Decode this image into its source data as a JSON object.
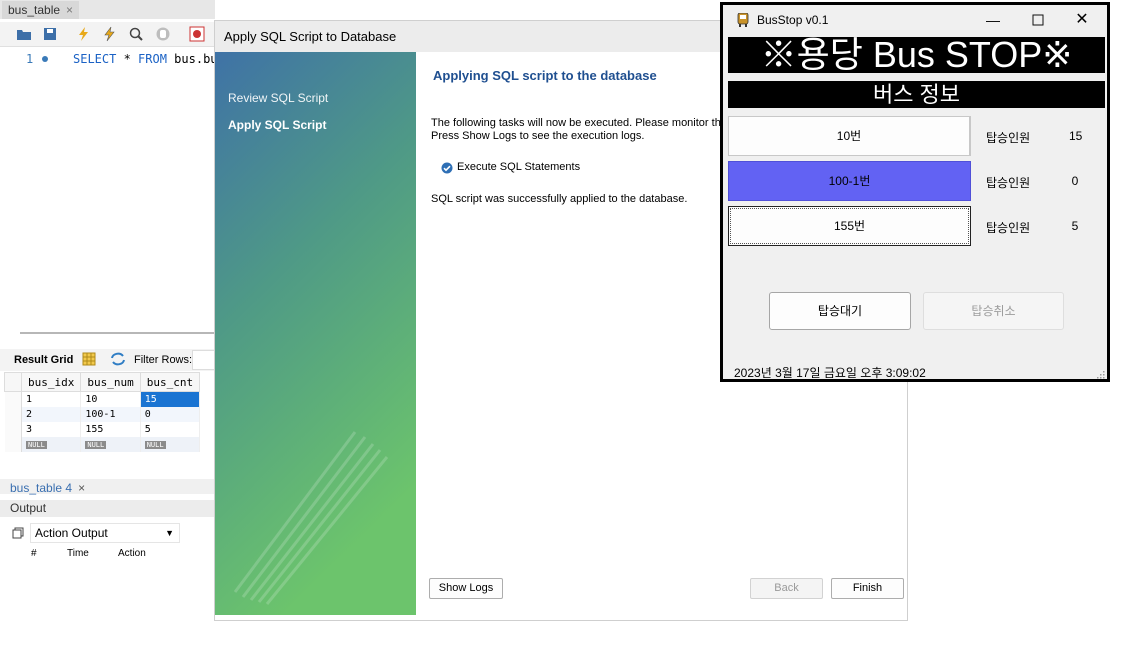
{
  "workbench": {
    "tab": "bus_table",
    "line_number": "1",
    "sql": {
      "select": "SELECT",
      "rest": " * ",
      "from": "FROM",
      "table": " bus.bus"
    },
    "result_grid_label": "Result Grid",
    "filter_label": "Filter Rows:",
    "grid": {
      "columns": [
        "bus_idx",
        "bus_num",
        "bus_cnt"
      ],
      "rows": [
        [
          "1",
          "10",
          "15"
        ],
        [
          "2",
          "100-1",
          "0"
        ],
        [
          "3",
          "155",
          "5"
        ]
      ],
      "null_label": "NULL"
    },
    "tab2": "bus_table 4",
    "output_header": "Output",
    "output_select": "Action Output",
    "output_columns": [
      "#",
      "Time",
      "Action"
    ]
  },
  "dialog": {
    "title": "Apply SQL Script to Database",
    "steps": [
      "Review SQL Script",
      "Apply SQL Script"
    ],
    "heading": "Applying SQL script to the database",
    "info_line1": "The following tasks will now be executed. Please monitor the",
    "info_line2": "Press Show Logs to see the execution logs.",
    "task": "Execute SQL Statements",
    "success": "SQL script was successfully applied to the database.",
    "buttons": {
      "show_logs": "Show Logs",
      "back": "Back",
      "finish": "Finish"
    }
  },
  "busstop": {
    "window_title": "BusStop v0.1",
    "banner": "※용당 Bus STOP※",
    "subbanner": "버스 정보",
    "buses": [
      {
        "label": "10번",
        "board_label": "탑승인원",
        "count": "15"
      },
      {
        "label": "100-1번",
        "board_label": "탑승인원",
        "count": "0"
      },
      {
        "label": "155번",
        "board_label": "탑승인원",
        "count": "5"
      }
    ],
    "wait_button": "탑승대기",
    "cancel_button": "탑승취소",
    "datetime": "2023년 3월 17일 금요일 오후 3:09:02",
    "colors": {
      "selected_bus": "#6262f3",
      "banner_bg": "#000000"
    }
  }
}
